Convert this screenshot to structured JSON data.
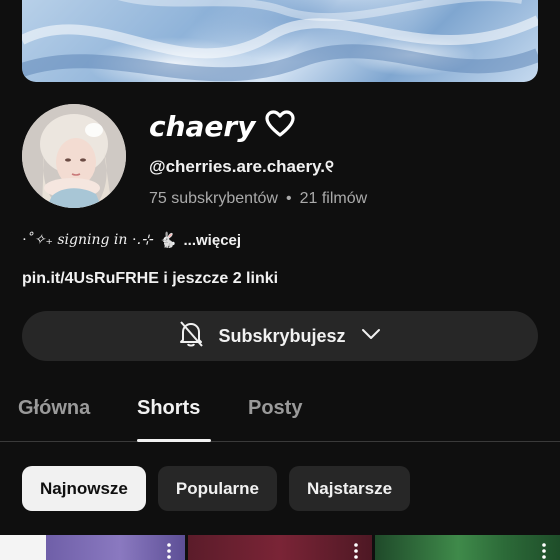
{
  "channel": {
    "name": "chaery",
    "handle": "@cherries.are.chaery.୧",
    "subscribers": "75 subskrybentów",
    "separator": "•",
    "videos": "21 filmów",
    "bio_prefix": "⋅˚✧₊ signing in ⋅.⊹",
    "bio_emoji": "🐇",
    "bio_more": "...więcej",
    "links": "pin.it/4UsRuFRHE i jeszcze 2 linki"
  },
  "subscribe": {
    "label": "Subskrybujesz",
    "icons": [
      "bell-off-icon",
      "chevron-down-icon"
    ]
  },
  "tabs": [
    {
      "label": "Główna",
      "active": false
    },
    {
      "label": "Shorts",
      "active": true
    },
    {
      "label": "Posty",
      "active": false
    }
  ],
  "filters": [
    {
      "label": "Najnowsze",
      "selected": true
    },
    {
      "label": "Popularne",
      "selected": false
    },
    {
      "label": "Najstarsze",
      "selected": false
    }
  ],
  "colors": {
    "background": "#0f0f0f",
    "chip": "#272727",
    "chip_selected": "#f1f1f1",
    "secondary_text": "#aaaaaa"
  }
}
